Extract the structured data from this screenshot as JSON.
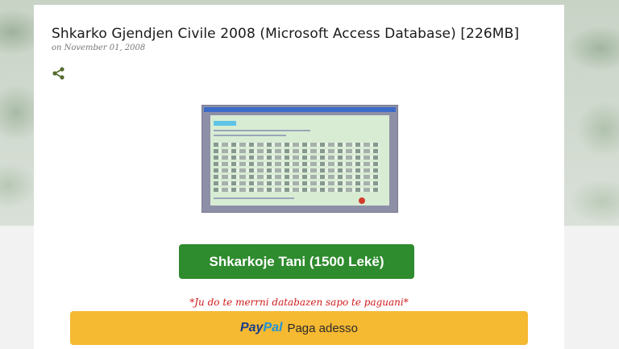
{
  "post": {
    "title": "Shkarko Gjendjen Civile 2008 (Microsoft Access Database) [226MB]",
    "date": "on November 01, 2008"
  },
  "icons": {
    "share": "share-icon"
  },
  "download_button": {
    "label": "Shkarkoje Tani (1500 Lekë)"
  },
  "payment_note": "*Ju do te merrni databazen sapo te paguani*",
  "paypal_button": {
    "logo_pay": "Pay",
    "logo_pal": "Pal",
    "label": "Paga adesso"
  },
  "colors": {
    "download_button": "#2e8b2e",
    "paypal_button": "#f5b932",
    "note_text": "#d11b1b",
    "share_icon": "#556b2f"
  }
}
